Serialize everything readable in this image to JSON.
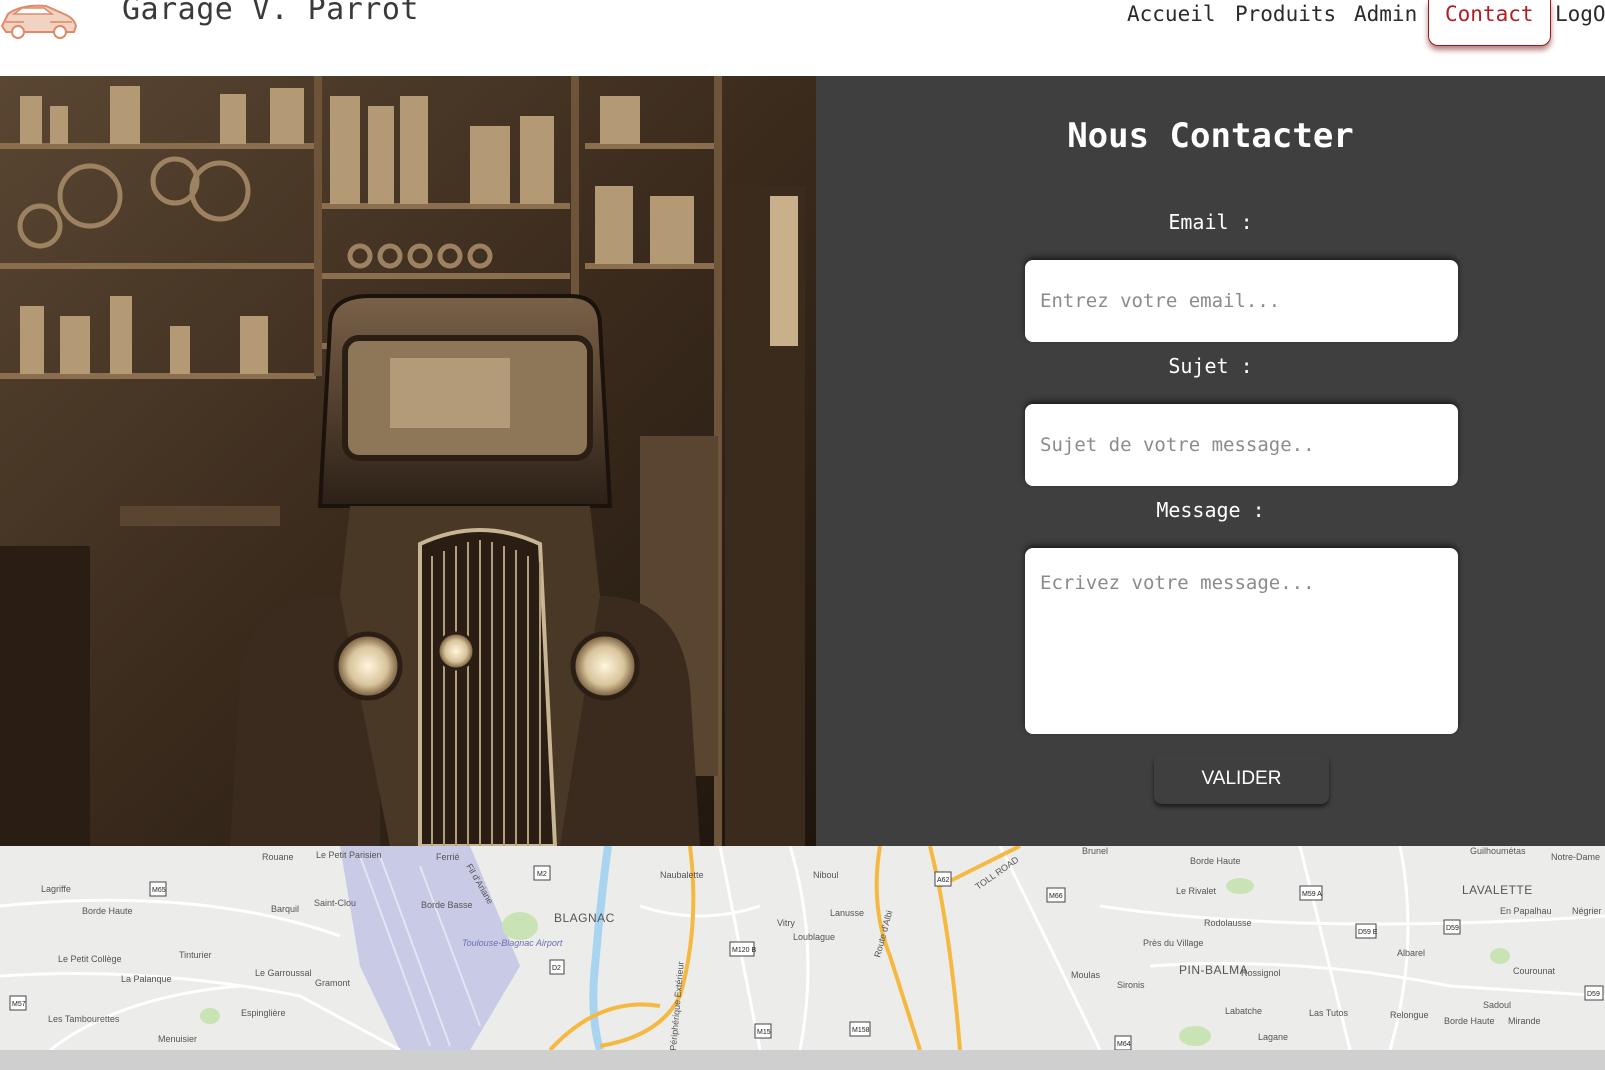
{
  "header": {
    "title": "Garage V. Parrot",
    "nav": [
      {
        "label": "Accueil",
        "active": false
      },
      {
        "label": "Produits",
        "active": false
      },
      {
        "label": "Admin",
        "active": false
      },
      {
        "label": "Contact",
        "active": true
      },
      {
        "label": "LogOut",
        "active": false
      }
    ]
  },
  "contact": {
    "title": "Nous Contacter",
    "email_label": "Email :",
    "email_placeholder": "Entrez votre email...",
    "subject_label": "Sujet :",
    "subject_placeholder": "Sujet de votre message..",
    "message_label": "Message :",
    "message_placeholder": "Ecrivez votre message...",
    "submit_label": "VALIDER"
  },
  "map": {
    "places": [
      "Rouane",
      "Le Petit Parisien",
      "Ferrié",
      "Fil d'Ariane",
      "Naubalette",
      "Niboul",
      "Route d'Albi",
      "TOLL ROAD",
      "Brunel",
      "Borde Haute",
      "Le Rivalet",
      "Guilhoumétas",
      "Notre-Dame",
      "LAVALETTE",
      "En Papalhau",
      "Négrier",
      "Lagriffe",
      "Borde Haute",
      "Barquil",
      "Saint-Clou",
      "Borde Basse",
      "BLAGNAC",
      "Périphérique Extérieur",
      "Vitry",
      "Lanusse",
      "Loublague",
      "Rodolausse",
      "Près du Village",
      "Albarel",
      "Toulouse-Blagnac Airport",
      "Le Petit Collège",
      "Tinturier",
      "La Palanque",
      "Le Garroussal",
      "Gramont",
      "Espinglière",
      "Les Tambourettes",
      "Menuisier",
      "Moulas",
      "Sironis",
      "PIN-BALMA",
      "Rossignol",
      "Courounat",
      "Sadoul",
      "Borde Haute",
      "Mirande",
      "Labatche",
      "Las Tutos",
      "Relongue",
      "Lagane"
    ],
    "road_shields": [
      "M2",
      "M65",
      "A62",
      "M66",
      "M59 A",
      "D59 E",
      "D59",
      "M120 B",
      "D2",
      "M57",
      "M15",
      "M158",
      "M64",
      "D59"
    ]
  }
}
